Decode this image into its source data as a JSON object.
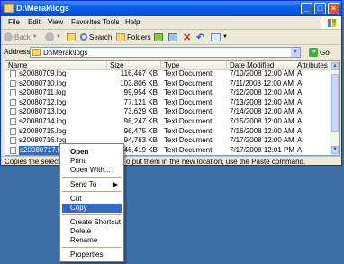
{
  "window": {
    "title": "D:\\Merak\\logs",
    "minimize": "_",
    "maximize": "□",
    "close": "×"
  },
  "menubar": [
    "File",
    "Edit",
    "View",
    "Favorites",
    "Tools",
    "Help"
  ],
  "toolbar": {
    "back": "Back",
    "search": "Search",
    "folders": "Folders"
  },
  "address": {
    "label": "Address",
    "value": "D:\\Merak\\logs",
    "go": "Go"
  },
  "list": {
    "columns": [
      "Name",
      "Size",
      "Type",
      "Date Modified",
      "Attributes"
    ],
    "rows": [
      {
        "name": "s20080709.log",
        "size": "116,467 KB",
        "type": "Text Document",
        "date": "7/10/2008 12:00 AM",
        "attr": "A"
      },
      {
        "name": "s20080710.log",
        "size": "103,806 KB",
        "type": "Text Document",
        "date": "7/11/2008 12:00 AM",
        "attr": "A"
      },
      {
        "name": "s20080711.log",
        "size": "99,954 KB",
        "type": "Text Document",
        "date": "7/12/2008 12:00 AM",
        "attr": "A"
      },
      {
        "name": "s20080712.log",
        "size": "77,121 KB",
        "type": "Text Document",
        "date": "7/13/2008 12:00 AM",
        "attr": "A"
      },
      {
        "name": "s20080713.log",
        "size": "73,629 KB",
        "type": "Text Document",
        "date": "7/14/2008 12:00 AM",
        "attr": "A"
      },
      {
        "name": "s20080714.log",
        "size": "98,247 KB",
        "type": "Text Document",
        "date": "7/15/2008 12:00 AM",
        "attr": "A"
      },
      {
        "name": "s20080715.log",
        "size": "96,475 KB",
        "type": "Text Document",
        "date": "7/16/2008 12:00 AM",
        "attr": "A"
      },
      {
        "name": "s20080716.log",
        "size": "94,763 KB",
        "type": "Text Document",
        "date": "7/17/2008 12:00 AM",
        "attr": "A"
      },
      {
        "name": "s20080717.log",
        "size": "46,419 KB",
        "type": "Text Document",
        "date": "7/17/2008 12:01 PM",
        "attr": "A"
      }
    ]
  },
  "status": {
    "text_left": "Copies the selected",
    "text_right": "o put them in the new location, use the Paste command."
  },
  "context_menu": {
    "open": "Open",
    "print": "Print",
    "open_with": "Open With...",
    "send_to": "Send To",
    "send_to_arrow": "▶",
    "cut": "Cut",
    "copy": "Copy",
    "create_shortcut": "Create Shortcut",
    "delete": "Delete",
    "rename": "Rename",
    "properties": "Properties"
  },
  "colors": {
    "titlebar": "#0a5de8",
    "selection": "#316ac5",
    "desktop": "#3a6ea5"
  }
}
